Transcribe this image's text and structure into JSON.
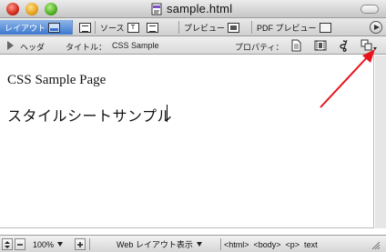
{
  "window": {
    "title": "sample.html"
  },
  "modebar": {
    "layout_tab": "レイアウト",
    "source_tab": "ソース",
    "preview_tab": "プレビュー",
    "pdf_preview_tab": "PDF プレビュー",
    "tag_icon_text": "T"
  },
  "infobar": {
    "header_label": "ヘッダ",
    "title_label": "タイトル：",
    "title_value": "CSS Sample",
    "properties_label": "プロパティ："
  },
  "document": {
    "heading_en": "CSS Sample Page",
    "heading_ja": "スタイルシートサンプル"
  },
  "statusbar": {
    "zoom": "100%",
    "view_mode": "Web レイアウト表示",
    "breadcrumb": "<html>  <body>  <p>  text"
  },
  "colors": {
    "active_tab": "#3c78d0",
    "annotation_arrow": "#e8141c"
  }
}
